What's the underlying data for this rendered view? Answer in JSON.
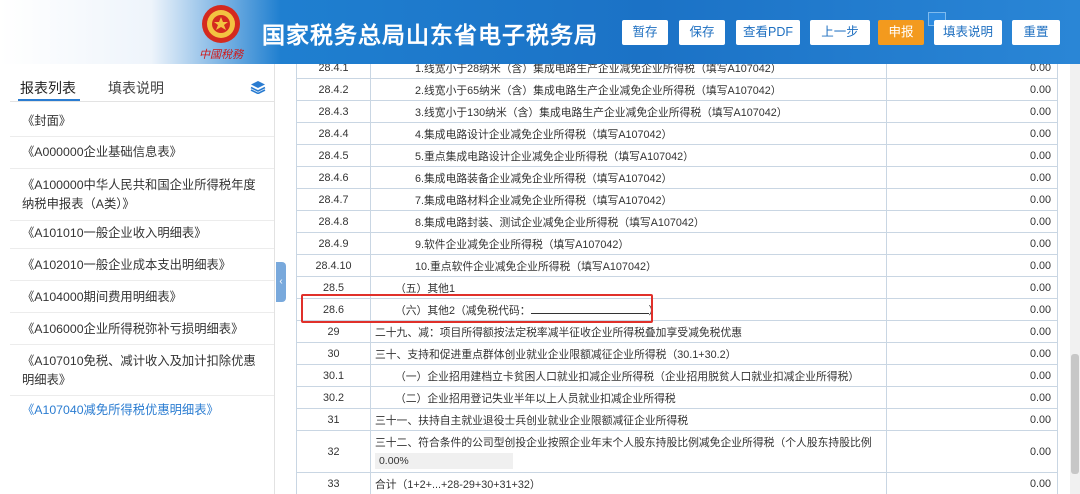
{
  "header": {
    "emblem_text": "中國稅務",
    "title": "国家税务总局山东省电子税务局",
    "buttons": [
      {
        "label": "暂存"
      },
      {
        "label": "保存"
      },
      {
        "label": "查看PDF"
      },
      {
        "label": "上一步"
      },
      {
        "label": "申报"
      },
      {
        "label": "填表说明"
      },
      {
        "label": "重置"
      }
    ]
  },
  "left": {
    "tab_list": "报表列表",
    "tab_help": "填表说明",
    "items": [
      "《封面》",
      "《A000000企业基础信息表》",
      "《A100000中华人民共和国企业所得税年度纳税申报表（A类）》",
      "《A101010一般企业收入明细表》",
      "《A102010一般企业成本支出明细表》",
      "《A104000期间费用明细表》",
      "《A106000企业所得税弥补亏损明细表》",
      "《A107010免税、减计收入及加计扣除优惠明细表》",
      "《A107040减免所得税优惠明细表》"
    ]
  },
  "table": {
    "rows": [
      {
        "num": "28.4.1",
        "desc": "1.线宽小于28纳米（含）集成电路生产企业减免企业所得税（填写A107042）",
        "value": "0.00",
        "indent": 2
      },
      {
        "num": "28.4.2",
        "desc": "2.线宽小于65纳米（含）集成电路生产企业减免企业所得税（填写A107042）",
        "value": "0.00",
        "indent": 2
      },
      {
        "num": "28.4.3",
        "desc": "3.线宽小于130纳米（含）集成电路生产企业减免企业所得税（填写A107042）",
        "value": "0.00",
        "indent": 2
      },
      {
        "num": "28.4.4",
        "desc": "4.集成电路设计企业减免企业所得税（填写A107042）",
        "value": "0.00",
        "indent": 2
      },
      {
        "num": "28.4.5",
        "desc": "5.重点集成电路设计企业减免企业所得税（填写A107042）",
        "value": "0.00",
        "indent": 2
      },
      {
        "num": "28.4.6",
        "desc": "6.集成电路装备企业减免企业所得税（填写A107042）",
        "value": "0.00",
        "indent": 2
      },
      {
        "num": "28.4.7",
        "desc": "7.集成电路材料企业减免企业所得税（填写A107042）",
        "value": "0.00",
        "indent": 2
      },
      {
        "num": "28.4.8",
        "desc": "8.集成电路封装、测试企业减免企业所得税（填写A107042）",
        "value": "0.00",
        "indent": 2
      },
      {
        "num": "28.4.9",
        "desc": "9.软件企业减免企业所得税（填写A107042）",
        "value": "0.00",
        "indent": 2
      },
      {
        "num": "28.4.10",
        "desc": "10.重点软件企业减免企业所得税（填写A107042）",
        "value": "0.00",
        "indent": 2
      },
      {
        "num": "28.5",
        "desc": "（五）其他1",
        "value": "0.00",
        "indent": 1
      },
      {
        "num": "28.6",
        "desc": "（六）其他2（减免税代码：",
        "desc_suffix": "）",
        "value": "0.00",
        "indent": 1,
        "field": true
      },
      {
        "num": "29",
        "desc": "二十九、减：项目所得额按法定税率减半征收企业所得税叠加享受减免税优惠",
        "value": "0.00",
        "indent": 0
      },
      {
        "num": "30",
        "desc": "三十、支持和促进重点群体创业就业企业限额减征企业所得税（30.1+30.2）",
        "value": "0.00",
        "indent": 0
      },
      {
        "num": "30.1",
        "desc": "（一）企业招用建档立卡贫困人口就业扣减企业所得税（企业招用脱贫人口就业扣减企业所得税）",
        "value": "0.00",
        "indent": 1
      },
      {
        "num": "30.2",
        "desc": "（二）企业招用登记失业半年以上人员就业扣减企业所得税",
        "value": "0.00",
        "indent": 1
      },
      {
        "num": "31",
        "desc": "三十一、扶持自主就业退役士兵创业就业企业限额减征企业所得税",
        "value": "0.00",
        "indent": 0
      },
      {
        "num": "32",
        "desc": "三十二、符合条件的公司型创投企业按照企业年末个人股东持股比例减免企业所得税（个人股东持股比例",
        "value": "0.00",
        "indent": 0,
        "pct": "0.00%"
      },
      {
        "num": "33",
        "desc": "合计（1+2+...+28-29+30+31+32）",
        "value": "0.00",
        "indent": 0
      }
    ]
  },
  "colors": {
    "header_blue": "#1b72c6",
    "active_button": "#f39a1e",
    "highlight": "#e0302a",
    "link_blue": "#2a7cd1"
  }
}
